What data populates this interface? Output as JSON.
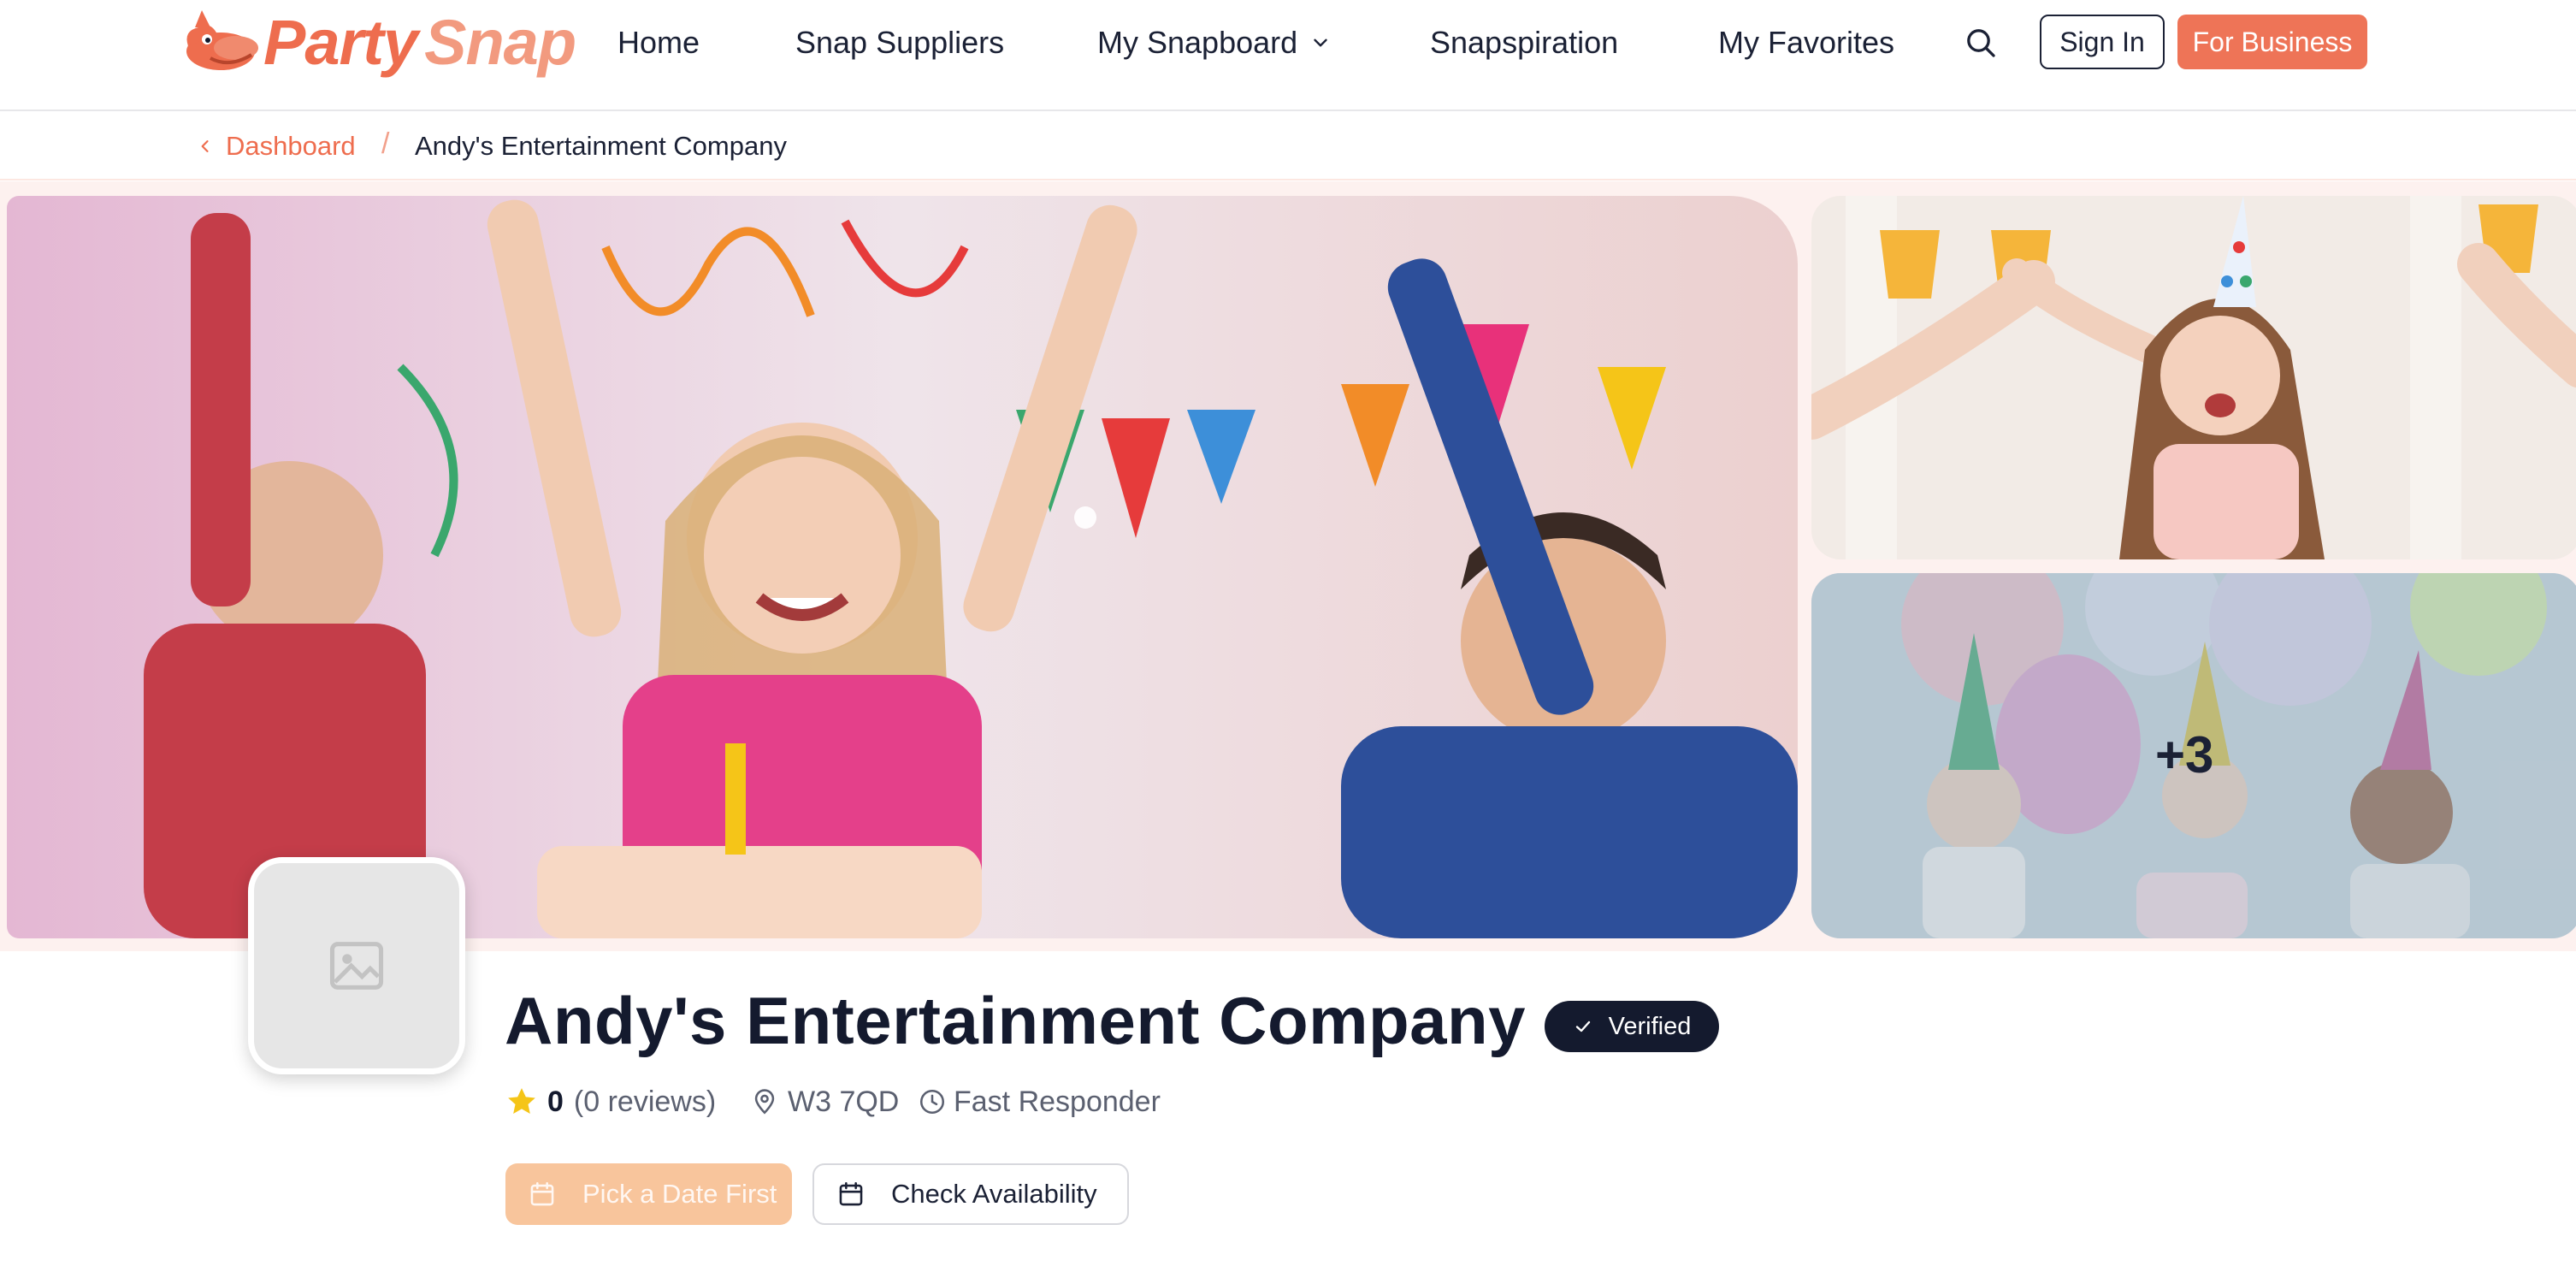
{
  "header": {
    "logo": {
      "word1": "Party",
      "word2": "Snap"
    },
    "nav": {
      "home": "Home",
      "suppliers": "Snap Suppliers",
      "snapboard": "My Snapboard",
      "inspiration": "Snapspiration",
      "favorites": "My Favorites"
    },
    "signin_label": "Sign In",
    "business_label": "For Business"
  },
  "breadcrumb": {
    "back_label": "Dashboard",
    "separator": "/",
    "current": "Andy's Entertainment Company"
  },
  "gallery": {
    "more_count": "+3",
    "images": [
      "kids-party-streamers-photo",
      "girl-party-hat-photo",
      "kids-balloons-party-photo"
    ]
  },
  "profile": {
    "name": "Andy's Entertainment Company",
    "verified_label": "Verified",
    "rating_score": "0",
    "reviews_text": "(0 reviews)",
    "location": "W3 7QD",
    "responder": "Fast Responder",
    "pick_date_label": "Pick a Date First",
    "check_availability_label": "Check Availability"
  },
  "colors": {
    "brand": "#ee6d4e",
    "brand_light": "#f29a7f",
    "navy": "#141a2e",
    "pick_button": "#f8c59c",
    "star": "#f5c518"
  },
  "icons": [
    "logo-mascot-icon",
    "chevron-down-icon",
    "search-icon",
    "chevron-left-icon",
    "image-placeholder-icon",
    "check-icon",
    "star-icon",
    "map-pin-icon",
    "clock-icon",
    "calendar-icon"
  ]
}
